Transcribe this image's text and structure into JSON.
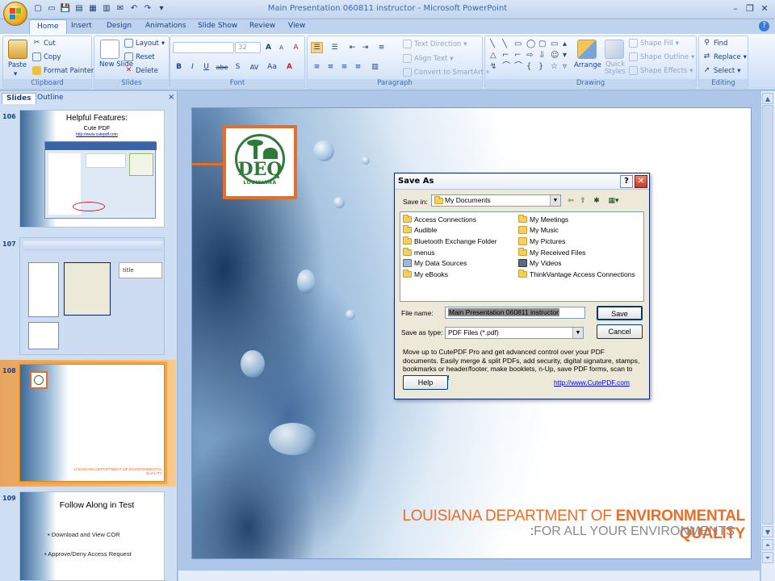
{
  "window": {
    "title": "Main Presentation 060811 instructor - Microsoft PowerPoint",
    "minimize": "–",
    "restore": "❐",
    "close": "✕"
  },
  "qat": [
    "💾",
    "↶",
    "↷"
  ],
  "ribbon": {
    "tabs": [
      "Home",
      "Insert",
      "Design",
      "Animations",
      "Slide Show",
      "Review",
      "View"
    ],
    "active_tab": "Home",
    "clipboard": {
      "label": "Clipboard",
      "paste": "Paste",
      "cut": "Cut",
      "copy": "Copy",
      "format_painter": "Format Painter"
    },
    "slides": {
      "label": "Slides",
      "new_slide": "New Slide",
      "layout": "Layout",
      "reset": "Reset",
      "delete": "Delete"
    },
    "font": {
      "label": "Font",
      "size": "32",
      "bold": "B",
      "italic": "I",
      "underline": "U",
      "strike": "abe",
      "shadow": "S",
      "spacing": "AV",
      "case": "Aa",
      "grow": "A",
      "shrink": "A",
      "clear": "A"
    },
    "paragraph": {
      "label": "Paragraph",
      "text_direction": "Text Direction",
      "align_text": "Align Text",
      "smartart": "Convert to SmartArt"
    },
    "drawing": {
      "label": "Drawing",
      "arrange": "Arrange",
      "quick_styles": "Quick Styles",
      "shape_fill": "Shape Fill",
      "shape_outline": "Shape Outline",
      "shape_effects": "Shape Effects"
    },
    "editing": {
      "label": "Editing",
      "find": "Find",
      "replace": "Replace",
      "select": "Select"
    }
  },
  "pane": {
    "tabs": [
      "Slides",
      "Outline"
    ],
    "close": "×",
    "slides": [
      {
        "num": "106",
        "title": "Helpful Features:",
        "subtitle": "Cute PDF",
        "link": "http://www.cutepdf.com"
      },
      {
        "num": "107",
        "label": "title"
      },
      {
        "num": "108",
        "dept": "LOUISIANA DEPARTMENT OF ENVIRONMENTAL QUALITY"
      },
      {
        "num": "109",
        "title": "Follow Along in Test",
        "bullets": [
          "Download and View COR",
          "Approve/Deny Access Request"
        ]
      }
    ]
  },
  "slide": {
    "logo_text": "DEQ",
    "logo_sub": "LOUISIANA",
    "dept_part1": "LOUISIANA DEPARTMENT OF ",
    "dept_part2": "ENVIRONMENTAL QUALITY",
    "tagline": "FOR ALL YOUR ENVIRONMENTS"
  },
  "dialog": {
    "title": "Save As",
    "help_btn": "?",
    "close_btn": "✕",
    "save_in_label": "Save in:",
    "save_in_value": "My Documents",
    "files_left": [
      "Access Connections",
      "Audible",
      "Bluetooth Exchange Folder",
      "menus",
      "My Data Sources",
      "My eBooks"
    ],
    "files_right": [
      "My Meetings",
      "My Music",
      "My Pictures",
      "My Received Files",
      "My Videos",
      "ThinkVantage Access Connections"
    ],
    "file_name_label": "File name:",
    "file_name_value": "Main Presentation 060811 instructor",
    "save_type_label": "Save as type:",
    "save_type_value": "PDF Files (*.pdf)",
    "save_btn": "Save",
    "cancel_btn": "Cancel",
    "promo": "Move up to CutePDF Pro and get advanced control over your PDF documents. Easily merge & split PDFs, add security, digital signature, stamps, bookmarks or header/footer, make booklets, n-Up, save PDF forms, scan to PDF and more!",
    "help": "Help",
    "link": "http://www.CutePDF.com"
  },
  "colors": {
    "deq_orange": "#e86d26",
    "deq_green": "#2f7a3a",
    "ribbon_blue": "#15428b"
  }
}
